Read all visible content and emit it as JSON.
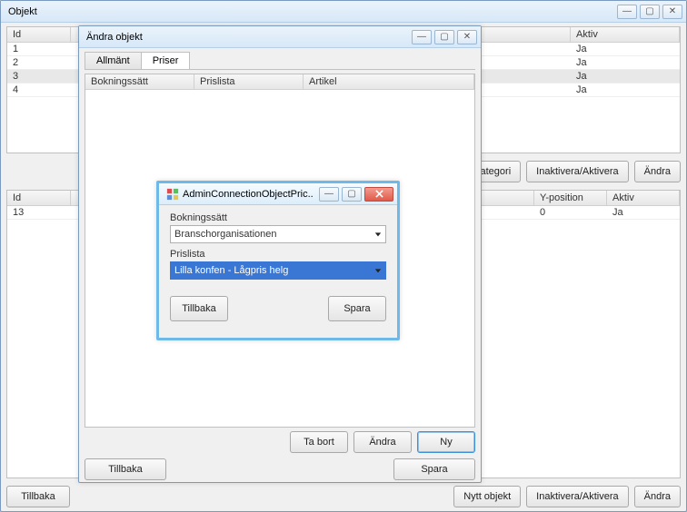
{
  "main_window": {
    "title": "Objekt",
    "top_grid": {
      "columns": [
        "Id",
        "Aktiv"
      ],
      "rows": [
        {
          "id": "1",
          "aktiv": "Ja"
        },
        {
          "id": "2",
          "aktiv": "Ja"
        },
        {
          "id": "3",
          "aktiv": "Ja"
        },
        {
          "id": "4",
          "aktiv": "Ja"
        }
      ],
      "selected_index": 2
    },
    "right_btns_upper": [
      "y kategori",
      "Inaktivera/Aktivera",
      "Ändra"
    ],
    "lower_grid": {
      "columns": [
        "Id",
        "Y-position",
        "Aktiv"
      ],
      "rows": [
        {
          "id": "13",
          "ypos": "0",
          "aktiv": "Ja"
        }
      ]
    },
    "bottom_btns": {
      "back": "Tillbaka",
      "new": "Nytt objekt",
      "toggle": "Inaktivera/Aktivera",
      "edit": "Ändra"
    }
  },
  "edit_dialog": {
    "title": "Ändra objekt",
    "tabs": [
      "Allmänt",
      "Priser"
    ],
    "active_tab": 1,
    "price_grid_cols": [
      "Bokningssätt",
      "Prislista",
      "Artikel"
    ],
    "footer_btns": {
      "delete": "Ta bort",
      "edit": "Ändra",
      "new": "Ny"
    },
    "bottom_btns": {
      "back": "Tillbaka",
      "save": "Spara"
    }
  },
  "admin_dialog": {
    "title": "AdminConnectionObjectPric..",
    "field1_label": "Bokningssätt",
    "field1_value": "Branschorganisationen",
    "field2_label": "Prislista",
    "field2_value": "Lilla konfen - Lågpris helg",
    "btn_back": "Tillbaka",
    "btn_save": "Spara"
  }
}
